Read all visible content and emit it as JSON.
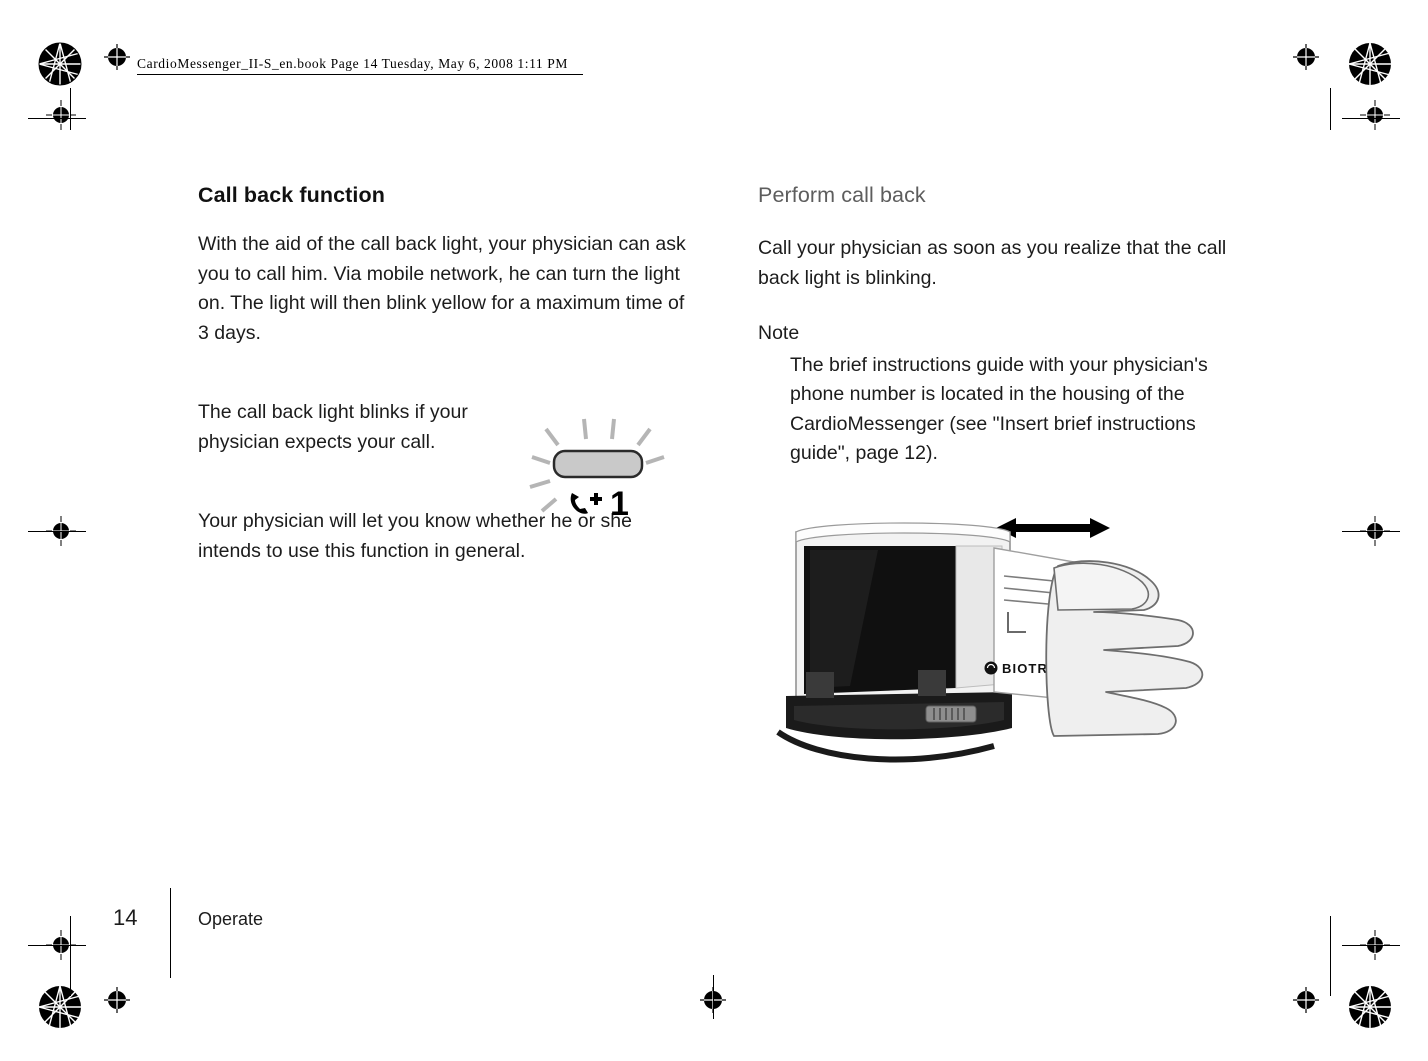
{
  "header": {
    "run_in": "CardioMessenger_II-S_en.book  Page 14  Tuesday, May 6, 2008  1:11 PM"
  },
  "left_column": {
    "title": "Call back function",
    "paragraph_1": "With the aid of the call back light, your physician can ask you to call him. Via mobile network, he can turn the light on. The light will then blink yellow for a maximum time of 3 days.",
    "paragraph_2": "The call back light blinks if your physician expects your call.",
    "paragraph_3": "Your physician will let you know whether he or she intends to use this function in general."
  },
  "right_column": {
    "title": "Perform call back",
    "paragraph_1": "Call your physician as soon as you realize that the call back light is blinking.",
    "note_label": "Note",
    "note_text": "The brief instructions guide with your physician's phone number is located in the housing of the CardioMessenger (see \"Insert brief instructions guide\", page   12)."
  },
  "figures": {
    "call_back_light": {
      "indicator_digit": "1",
      "icon": "handset-phone-icon"
    },
    "device_photo": {
      "brand_label": "BIOTRONIK",
      "alt": "Hand inserting brief instructions guide card into CardioMessenger housing"
    }
  },
  "footer": {
    "page_number": "14",
    "chapter": "Operate"
  },
  "colors": {
    "text": "#1c1c1c",
    "title_light": "#5d5d5d",
    "accent_black": "#000000"
  }
}
